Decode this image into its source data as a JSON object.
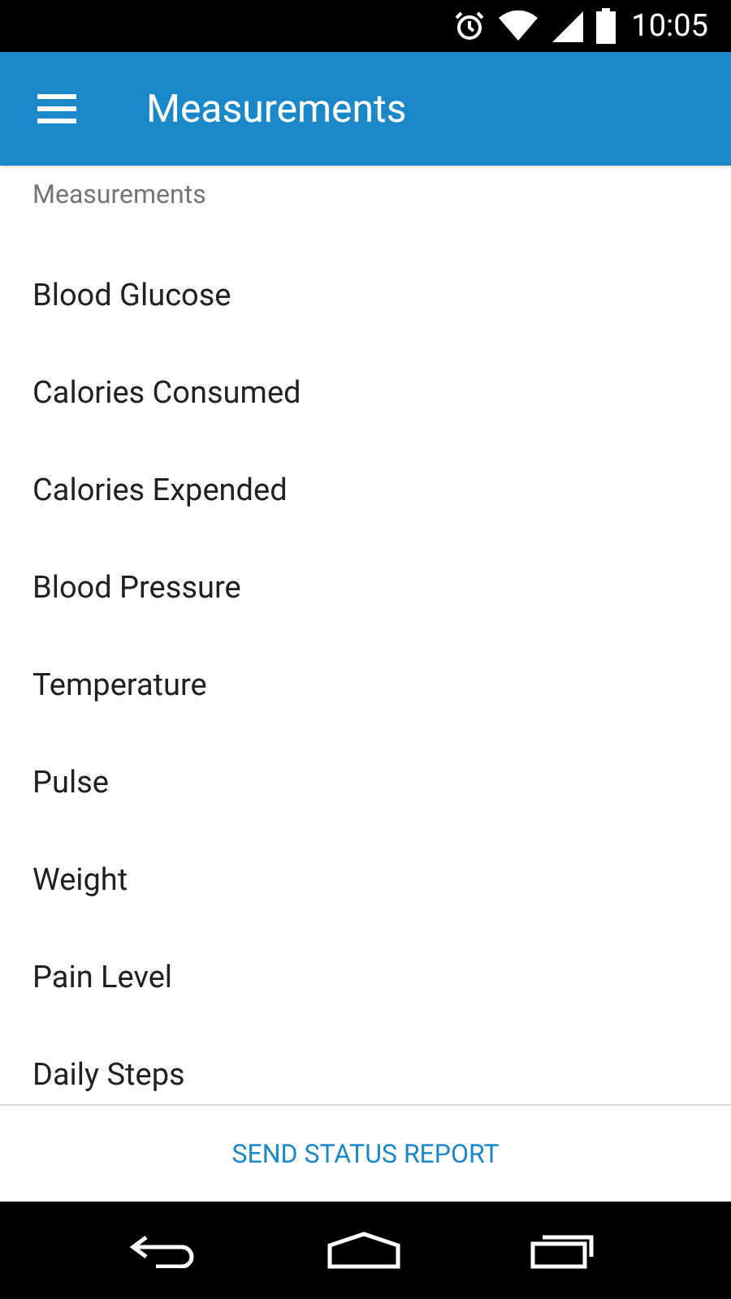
{
  "status_bar": {
    "time": "10:05"
  },
  "app_bar": {
    "title": "Measurements"
  },
  "section": {
    "title": "Measurements"
  },
  "items": [
    {
      "label": "Blood Glucose"
    },
    {
      "label": "Calories Consumed"
    },
    {
      "label": "Calories Expended"
    },
    {
      "label": "Blood Pressure"
    },
    {
      "label": "Temperature"
    },
    {
      "label": "Pulse"
    },
    {
      "label": "Weight"
    },
    {
      "label": "Pain Level"
    },
    {
      "label": "Daily Steps"
    }
  ],
  "footer_button": {
    "label": "SEND STATUS REPORT"
  }
}
